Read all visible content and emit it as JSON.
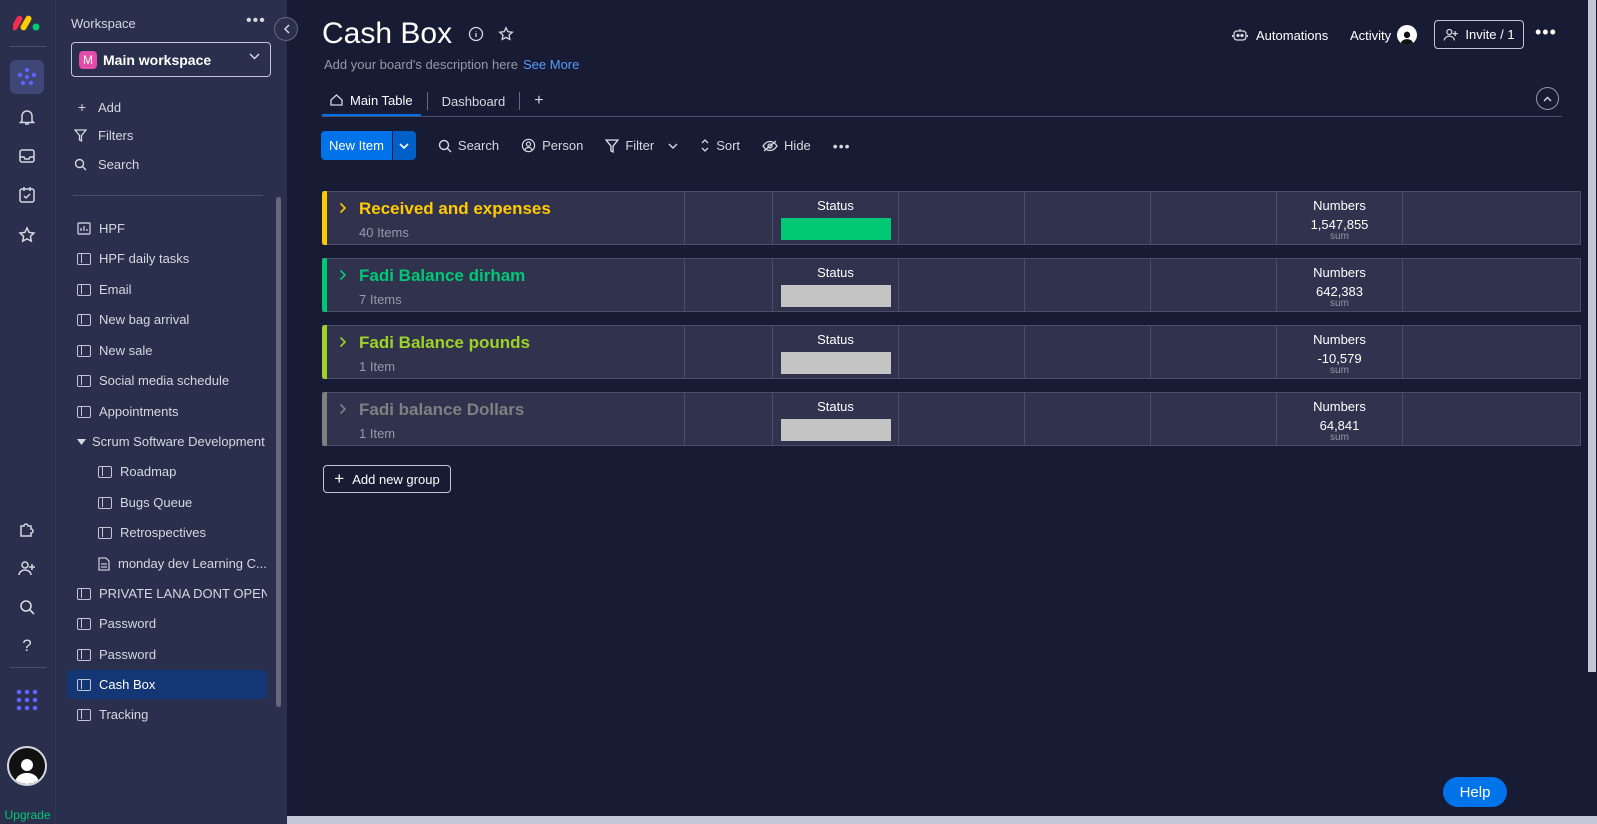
{
  "rail": {
    "upgrade_label": "Upgrade"
  },
  "sidebar": {
    "workspace_label": "Workspace",
    "workspace_badge": "M",
    "workspace_name": "Main workspace",
    "actions": [
      {
        "label": "Add",
        "icon": "plus-icon"
      },
      {
        "label": "Filters",
        "icon": "filter-icon"
      },
      {
        "label": "Search",
        "icon": "search-icon"
      }
    ],
    "boards": [
      {
        "label": "HPF"
      },
      {
        "label": "HPF daily tasks"
      },
      {
        "label": "Email"
      },
      {
        "label": "New bag arrival"
      },
      {
        "label": "New sale"
      },
      {
        "label": "Social media schedule"
      },
      {
        "label": "Appointments"
      },
      {
        "label": "Scrum Software Development"
      },
      {
        "label": "Roadmap"
      },
      {
        "label": "Bugs Queue"
      },
      {
        "label": "Retrospectives"
      },
      {
        "label": "monday dev Learning C..."
      },
      {
        "label": "PRIVATE LANA DONT OPEN"
      },
      {
        "label": "Password"
      },
      {
        "label": "Password"
      },
      {
        "label": "Cash Box"
      },
      {
        "label": "Tracking"
      }
    ]
  },
  "header": {
    "title": "Cash Box",
    "description": "Add your board's description here",
    "see_more": "See More",
    "automations": "Automations",
    "activity": "Activity",
    "invite": "Invite / 1"
  },
  "tabs": [
    {
      "label": "Main Table"
    },
    {
      "label": "Dashboard"
    },
    {
      "label": "+"
    }
  ],
  "toolbar": {
    "new_item": "New Item",
    "search": "Search",
    "person": "Person",
    "filter": "Filter",
    "sort": "Sort",
    "hide": "Hide"
  },
  "groups": [
    {
      "name": "Received and expenses",
      "count": "40 Items",
      "color": "#ffcb00",
      "status_label": "Status",
      "status_color": "#00c875",
      "numbers_label": "Numbers",
      "numbers_value": "1,547,855",
      "numbers_sum": "sum"
    },
    {
      "name": "Fadi Balance dirham",
      "count": "7 Items",
      "color": "#00c875",
      "status_label": "Status",
      "status_color": "#c4c4c4",
      "numbers_label": "Numbers",
      "numbers_value": "642,383",
      "numbers_sum": "sum"
    },
    {
      "name": "Fadi Balance pounds",
      "count": "1 Item",
      "color": "#9cd326",
      "status_label": "Status",
      "status_color": "#c4c4c4",
      "numbers_label": "Numbers",
      "numbers_value": "-10,579",
      "numbers_sum": "sum"
    },
    {
      "name": "Fadi balance Dollars",
      "count": "1 Item",
      "color": "#808080",
      "status_label": "Status",
      "status_color": "#c4c4c4",
      "numbers_label": "Numbers",
      "numbers_value": "64,841",
      "numbers_sum": "sum"
    }
  ],
  "add_group": "Add new group",
  "help": "Help"
}
